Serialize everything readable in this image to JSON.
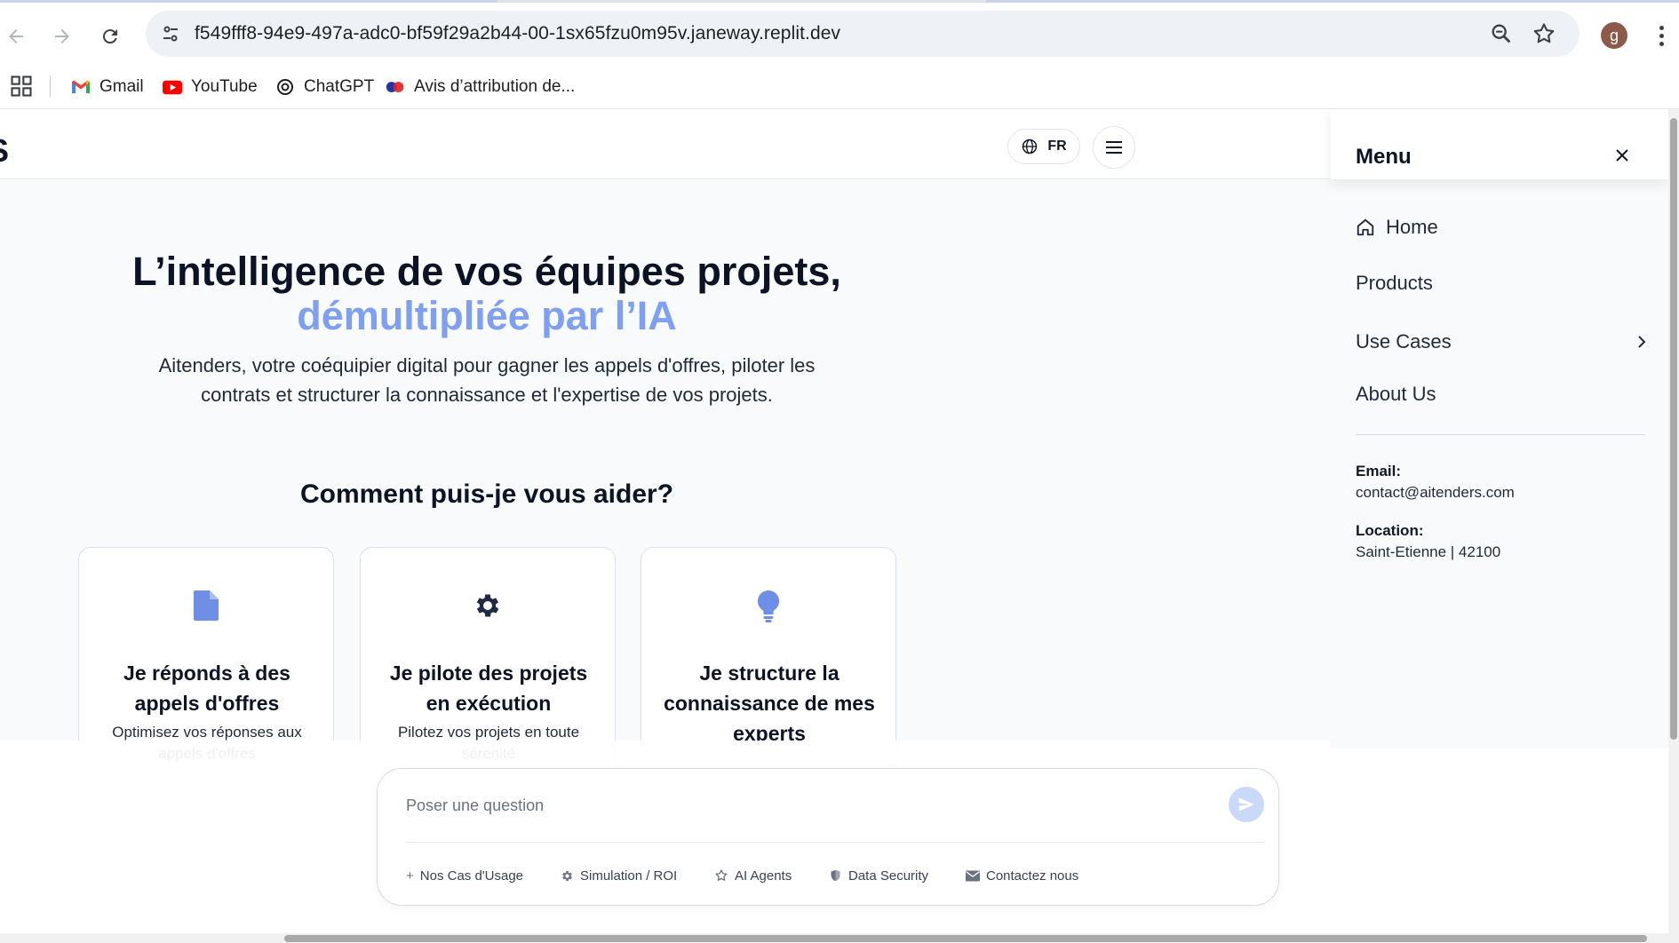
{
  "browser": {
    "url": "f549fff8-94e9-497a-adc0-bf59f29a2b44-00-1sx65fzu0m95v.janeway.replit.dev",
    "profile_initial": "g",
    "bookmarks": [
      {
        "label": "Gmail",
        "icon": "gmail-icon"
      },
      {
        "label": "YouTube",
        "icon": "youtube-icon"
      },
      {
        "label": "ChatGPT",
        "icon": "chatgpt-icon"
      },
      {
        "label": "Avis d’attribution de...",
        "icon": "avis-icon"
      }
    ]
  },
  "header": {
    "logo_fragment": "S",
    "language": "FR"
  },
  "hero": {
    "title_line1": "L’intelligence de vos équipes projets,",
    "title_line2": "démultipliée par l’IA",
    "subtitle_line1": "Aitenders, votre coéquipier digital pour gagner les appels d'offres, piloter les",
    "subtitle_line2": "contrats et structurer la connaissance et l'expertise de vos projets.",
    "help_title": "Comment puis-je vous aider?"
  },
  "cards": [
    {
      "icon": "document-icon",
      "title": "Je réponds à des appels d'offres",
      "desc": "Optimisez vos réponses aux appels d'offres"
    },
    {
      "icon": "gear-icon",
      "title": "Je pilote des projets en exécution",
      "desc": "Pilotez vos projets en toute sérénité"
    },
    {
      "icon": "lightbulb-icon",
      "title": "Je structure la connaissance de mes experts",
      "desc": ""
    }
  ],
  "chat": {
    "placeholder": "Poser une question",
    "chips": [
      {
        "label": "Nos Cas d'Usage",
        "icon": "plus-icon"
      },
      {
        "label": "Simulation / ROI",
        "icon": "gear-icon"
      },
      {
        "label": "AI Agents",
        "icon": "star-icon"
      },
      {
        "label": "Data Security",
        "icon": "shield-icon"
      },
      {
        "label": "Contactez nous",
        "icon": "mail-icon"
      }
    ]
  },
  "menu": {
    "title": "Menu",
    "items": [
      {
        "label": "Home",
        "icon": "home-icon"
      },
      {
        "label": "Products"
      },
      {
        "label": "Use Cases"
      },
      {
        "label": "About Us"
      }
    ],
    "email_label": "Email:",
    "email_value": "contact@aitenders.com",
    "location_label": "Location:",
    "location_value": "Saint-Etienne | 42100"
  },
  "colors": {
    "accent": "#7f9ff0",
    "icon_blue": "#6f8fe6",
    "dark_text": "#0b1324"
  }
}
